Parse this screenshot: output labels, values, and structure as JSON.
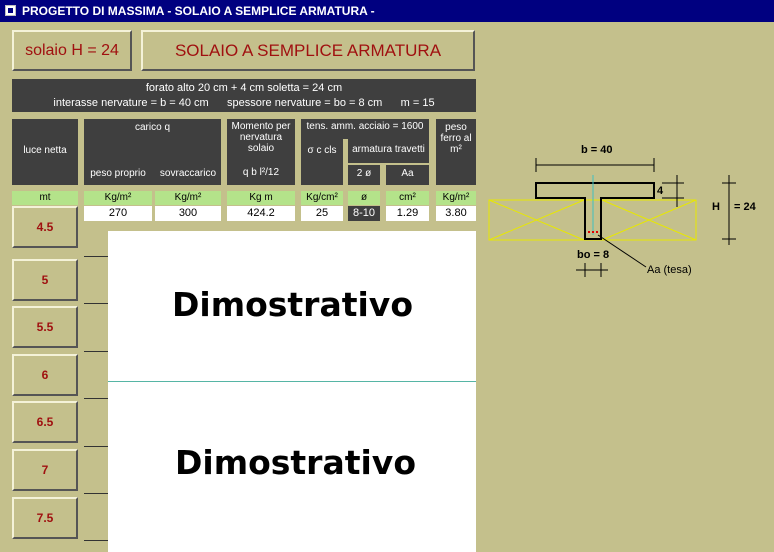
{
  "window": {
    "title": "PROGETTO DI MASSIMA - SOLAIO A SEMPLICE ARMATURA -"
  },
  "header": {
    "solaio_button": "solaio H = 24",
    "title_button": "SOLAIO A SEMPLICE ARMATURA"
  },
  "info": {
    "line1": "forato alto 20 cm + 4 cm soletta = 24 cm",
    "line2": "interasse nervature = b = 40 cm      spessore nervature = bo = 8 cm      m = 15"
  },
  "table": {
    "h_luce": "luce netta",
    "h_carico": "carico q",
    "h_peso_proprio": "peso proprio",
    "h_sovraccarico": "sovraccarico",
    "h_momento": "Momento per nervatura solaio",
    "h_momento_formula": "q b l²/12",
    "h_tens": "tens. amm. acciaio = 1600",
    "h_sigma": "σ c cls",
    "h_armatura": "armatura travetti",
    "h_diam": "2 ø",
    "h_aa": "Aa",
    "h_peso_ferro": "peso ferro al m²",
    "units": [
      "mt",
      "Kg/m²",
      "Kg/m²",
      "Kg m",
      "Kg/cm²",
      "ø",
      "cm²",
      "Kg/m²"
    ],
    "row1": [
      "270",
      "300",
      "424.2",
      "25",
      "8-10",
      "1.29",
      "3.80"
    ],
    "spans": [
      "4.5",
      "5",
      "5.5",
      "6",
      "6.5",
      "7",
      "7.5"
    ]
  },
  "diagram": {
    "b_label": "b = 40",
    "thick_label": "4",
    "h_label": "H",
    "h_value": "= 24",
    "bo_label": "bo = 8",
    "aa_label": "Aa (tesa)"
  },
  "watermark": {
    "text1": "Dimostrativo",
    "text2": "Dimostrativo"
  }
}
